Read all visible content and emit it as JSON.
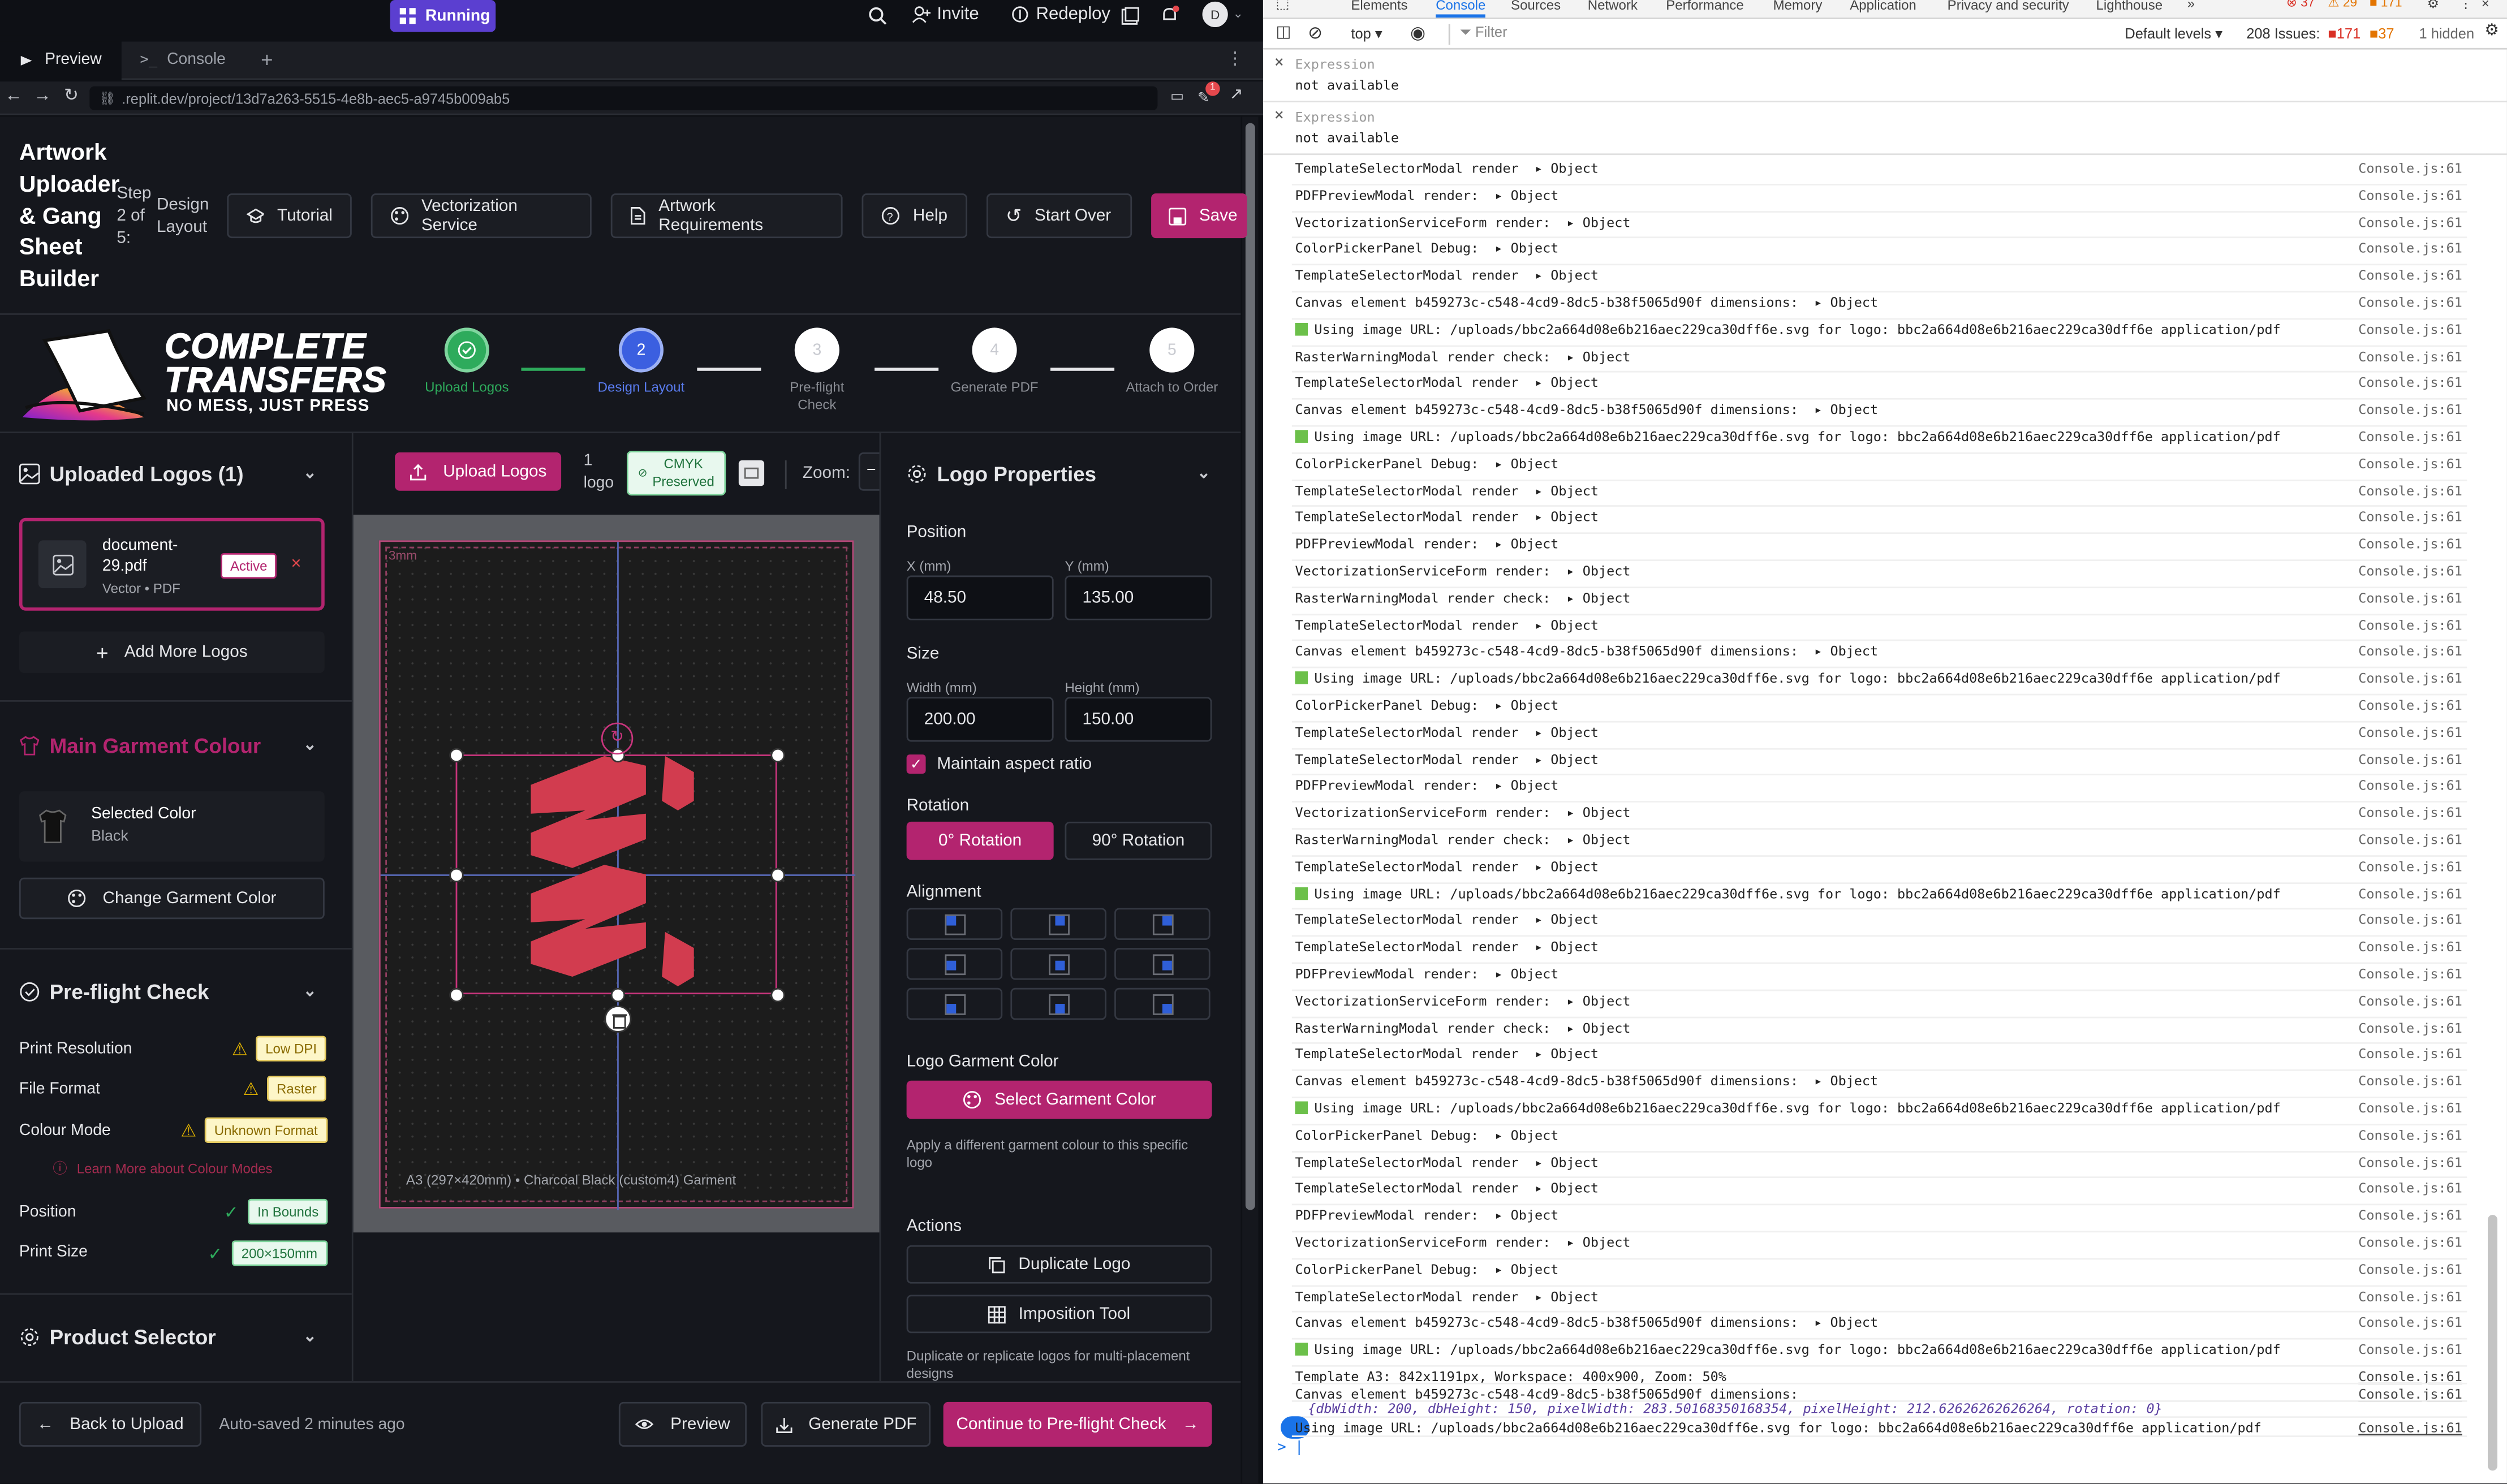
{
  "replit": {
    "status": "Running",
    "invite": "Invite",
    "redeploy": "Redeploy",
    "avatar_letter": "D",
    "tabs": [
      "Preview",
      "Console"
    ],
    "url": ".replit.dev/project/13d7a263-5515-4e8b-aec5-a9745b009ab5",
    "notif_count": "1"
  },
  "app": {
    "title": "Artwork Uploader & Gang Sheet Builder",
    "step_text": "Step 2 of 5:",
    "step_name": "Design Layout",
    "buttons": {
      "tutorial": "Tutorial",
      "vectorization": "Vectorization Service",
      "requirements": "Artwork Requirements",
      "help": "Help",
      "start_over": "Start Over",
      "save": "Save"
    },
    "brand": {
      "line1": "COMPLETE",
      "line2": "TRANSFERS",
      "tagline": "NO MESS, JUST PRESS"
    },
    "progress": [
      {
        "num": "✓",
        "label": "Upload Logos",
        "state": "done"
      },
      {
        "num": "2",
        "label": "Design Layout",
        "state": "active"
      },
      {
        "num": "3",
        "label": "Pre-flight Check",
        "state": "todo"
      },
      {
        "num": "4",
        "label": "Generate PDF",
        "state": "todo"
      },
      {
        "num": "5",
        "label": "Attach to Order",
        "state": "todo"
      }
    ],
    "left": {
      "uploaded_title": "Uploaded Logos (1)",
      "file_name": "document-29.pdf",
      "file_meta": "Vector • PDF",
      "active_badge": "Active",
      "add_more": "Add More Logos",
      "garment_title": "Main Garment Colour",
      "selected_color_label": "Selected Color",
      "selected_color_value": "Black",
      "change_color": "Change Garment Color",
      "preflight_title": "Pre-flight Check",
      "preflight": [
        {
          "label": "Print Resolution",
          "badge": "Low DPI",
          "status": "warn"
        },
        {
          "label": "File Format",
          "badge": "Raster",
          "status": "warn"
        },
        {
          "label": "Colour Mode",
          "badge": "Unknown Format",
          "status": "warn"
        },
        {
          "label": "Position",
          "badge": "In Bounds",
          "status": "ok"
        },
        {
          "label": "Print Size",
          "badge": "200×150mm",
          "status": "ok"
        }
      ],
      "learn_more": "Learn More about Colour Modes",
      "product_title": "Product Selector"
    },
    "toolbar": {
      "upload": "Upload Logos",
      "count": "1 logo",
      "cmyk": "CMYK Preserved",
      "zoom": "Zoom:"
    },
    "canvas": {
      "margin_label": "3mm",
      "caption": "A3 (297×420mm) • Charcoal Black (custom4) Garment"
    },
    "right": {
      "title": "Logo Properties",
      "position": "Position",
      "x_label": "X (mm)",
      "x_value": "48.50",
      "y_label": "Y (mm)",
      "y_value": "135.00",
      "size": "Size",
      "w_label": "Width (mm)",
      "w_value": "200.00",
      "h_label": "Height (mm)",
      "h_value": "150.00",
      "aspect": "Maintain aspect ratio",
      "rotation": "Rotation",
      "rot0": "0° Rotation",
      "rot90": "90° Rotation",
      "alignment": "Alignment",
      "garment_color": "Logo Garment Color",
      "select_garment": "Select Garment Color",
      "garment_help": "Apply a different garment colour to this specific logo",
      "actions": "Actions",
      "duplicate": "Duplicate Logo",
      "imposition": "Imposition Tool",
      "actions_help": "Duplicate or replicate logos for multi-placement designs"
    },
    "footer": {
      "back": "Back to Upload",
      "autosave": "Auto-saved 2 minutes ago",
      "preview": "Preview",
      "generate": "Generate PDF",
      "continue": "Continue to Pre-flight Check"
    }
  },
  "devtools": {
    "tabs": [
      "Elements",
      "Console",
      "Sources",
      "Network",
      "Performance",
      "Memory",
      "Application",
      "Privacy and security",
      "Lighthouse"
    ],
    "context": "top",
    "filter_placeholder": "Filter",
    "levels": "Default levels",
    "issues": "208 Issues:",
    "issue_counts": [
      "171",
      "37"
    ],
    "hidden": "1 hidden",
    "expression_label": "Expression",
    "expression_value": "not available",
    "source": "Console.js:61",
    "logs": [
      {
        "t": "TemplateSelectorModal render",
        "o": "Object"
      },
      {
        "t": "PDFPreviewModal render:",
        "o": "Object"
      },
      {
        "t": "VectorizationServiceForm render:",
        "o": "Object"
      },
      {
        "t": "ColorPickerPanel Debug:",
        "o": "Object"
      },
      {
        "t": "TemplateSelectorModal render",
        "o": "Object"
      },
      {
        "t": "Canvas element b459273c-c548-4cd9-8dc5-b38f5065d90f dimensions:",
        "o": "Object"
      },
      {
        "t": "Using image URL: /uploads/bbc2a664d08e6b216aec229ca30dff6e.svg for logo: bbc2a664d08e6b216aec229ca30dff6e application/pdf",
        "o": "",
        "img": true
      },
      {
        "t": "RasterWarningModal render check:",
        "o": "Object"
      },
      {
        "t": "TemplateSelectorModal render",
        "o": "Object"
      },
      {
        "t": "Canvas element b459273c-c548-4cd9-8dc5-b38f5065d90f dimensions:",
        "o": "Object"
      },
      {
        "t": "Using image URL: /uploads/bbc2a664d08e6b216aec229ca30dff6e.svg for logo: bbc2a664d08e6b216aec229ca30dff6e application/pdf",
        "o": "",
        "img": true
      },
      {
        "t": "ColorPickerPanel Debug:",
        "o": "Object"
      },
      {
        "t": "TemplateSelectorModal render",
        "o": "Object"
      },
      {
        "t": "TemplateSelectorModal render",
        "o": "Object"
      },
      {
        "t": "PDFPreviewModal render:",
        "o": "Object"
      },
      {
        "t": "VectorizationServiceForm render:",
        "o": "Object"
      },
      {
        "t": "RasterWarningModal render check:",
        "o": "Object"
      },
      {
        "t": "TemplateSelectorModal render",
        "o": "Object"
      },
      {
        "t": "Canvas element b459273c-c548-4cd9-8dc5-b38f5065d90f dimensions:",
        "o": "Object"
      },
      {
        "t": "Using image URL: /uploads/bbc2a664d08e6b216aec229ca30dff6e.svg for logo: bbc2a664d08e6b216aec229ca30dff6e application/pdf",
        "o": "",
        "img": true
      },
      {
        "t": "ColorPickerPanel Debug:",
        "o": "Object"
      },
      {
        "t": "TemplateSelectorModal render",
        "o": "Object"
      },
      {
        "t": "TemplateSelectorModal render",
        "o": "Object"
      },
      {
        "t": "PDFPreviewModal render:",
        "o": "Object"
      },
      {
        "t": "VectorizationServiceForm render:",
        "o": "Object"
      },
      {
        "t": "RasterWarningModal render check:",
        "o": "Object"
      },
      {
        "t": "TemplateSelectorModal render",
        "o": "Object"
      },
      {
        "t": "Using image URL: /uploads/bbc2a664d08e6b216aec229ca30dff6e.svg for logo: bbc2a664d08e6b216aec229ca30dff6e application/pdf",
        "o": "",
        "img": true
      },
      {
        "t": "TemplateSelectorModal render",
        "o": "Object"
      },
      {
        "t": "TemplateSelectorModal render",
        "o": "Object"
      },
      {
        "t": "PDFPreviewModal render:",
        "o": "Object"
      },
      {
        "t": "VectorizationServiceForm render:",
        "o": "Object"
      },
      {
        "t": "RasterWarningModal render check:",
        "o": "Object"
      },
      {
        "t": "TemplateSelectorModal render",
        "o": "Object"
      },
      {
        "t": "Canvas element b459273c-c548-4cd9-8dc5-b38f5065d90f dimensions:",
        "o": "Object"
      },
      {
        "t": "Using image URL: /uploads/bbc2a664d08e6b216aec229ca30dff6e.svg for logo: bbc2a664d08e6b216aec229ca30dff6e application/pdf",
        "o": "",
        "img": true
      },
      {
        "t": "ColorPickerPanel Debug:",
        "o": "Object"
      },
      {
        "t": "TemplateSelectorModal render",
        "o": "Object"
      },
      {
        "t": "TemplateSelectorModal render",
        "o": "Object"
      },
      {
        "t": "PDFPreviewModal render:",
        "o": "Object"
      },
      {
        "t": "VectorizationServiceForm render:",
        "o": "Object"
      },
      {
        "t": "ColorPickerPanel Debug:",
        "o": "Object"
      },
      {
        "t": "TemplateSelectorModal render",
        "o": "Object"
      },
      {
        "t": "Canvas element b459273c-c548-4cd9-8dc5-b38f5065d90f dimensions:",
        "o": "Object"
      },
      {
        "t": "Using image URL: /uploads/bbc2a664d08e6b216aec229ca30dff6e.svg for logo: bbc2a664d08e6b216aec229ca30dff6e application/pdf",
        "o": "",
        "img": true
      },
      {
        "t": "Template A3: 842x1191px, Workspace: 400x900, Zoom: 50%",
        "o": "",
        "u": true
      },
      {
        "t": "Canvas element b459273c-c548-4cd9-8dc5-b38f5065d90f dimensions:",
        "o": "",
        "u": true
      },
      {
        "t": "{dbWidth: 200, dbHeight: 150, pixelWidth: 283.50168350168354, pixelHeight: 212.62626262626264, rotation: 0}",
        "o": "",
        "italic": true,
        "nosrc": true
      },
      {
        "t": "Using image URL: /uploads/bbc2a664d08e6b216aec229ca30dff6e.svg for logo: bbc2a664d08e6b216aec229ca30dff6e application/pdf",
        "o": "",
        "u": true,
        "badge": true
      }
    ]
  }
}
